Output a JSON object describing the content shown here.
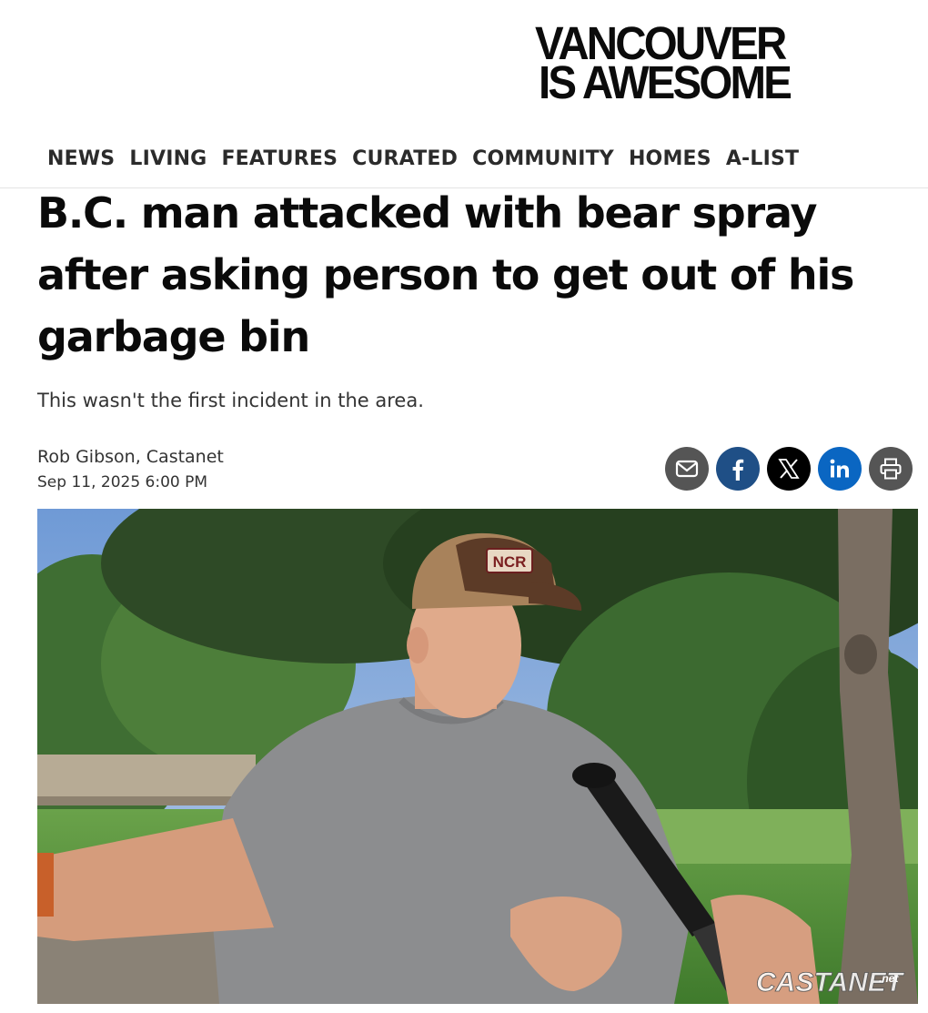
{
  "site": {
    "logo_line1": "VANCOUVER",
    "logo_line2": "IS AWESOME"
  },
  "nav": [
    "NEWS",
    "LIVING",
    "FEATURES",
    "CURATED",
    "COMMUNITY",
    "HOMES",
    "A-LIST"
  ],
  "article": {
    "headline": "B.C. man attacked with bear spray after asking person to get out of his garbage bin",
    "dek": "This wasn't the first incident in the area.",
    "byline": "Rob Gibson, Castanet",
    "date": "Sep 11, 2025 6:00 PM"
  },
  "share": [
    {
      "name": "email",
      "icon": "envelope-icon",
      "color": "#555555"
    },
    {
      "name": "facebook",
      "icon": "facebook-icon",
      "color": "#1f4f86"
    },
    {
      "name": "x",
      "icon": "x-icon",
      "color": "#000000"
    },
    {
      "name": "linkedin",
      "icon": "linkedin-icon",
      "color": "#0a66c2"
    },
    {
      "name": "print",
      "icon": "printer-icon",
      "color": "#555555"
    }
  ],
  "photo": {
    "cap_text": "NCR",
    "watermark": "CASTANET",
    "watermark_suffix": ".net"
  }
}
